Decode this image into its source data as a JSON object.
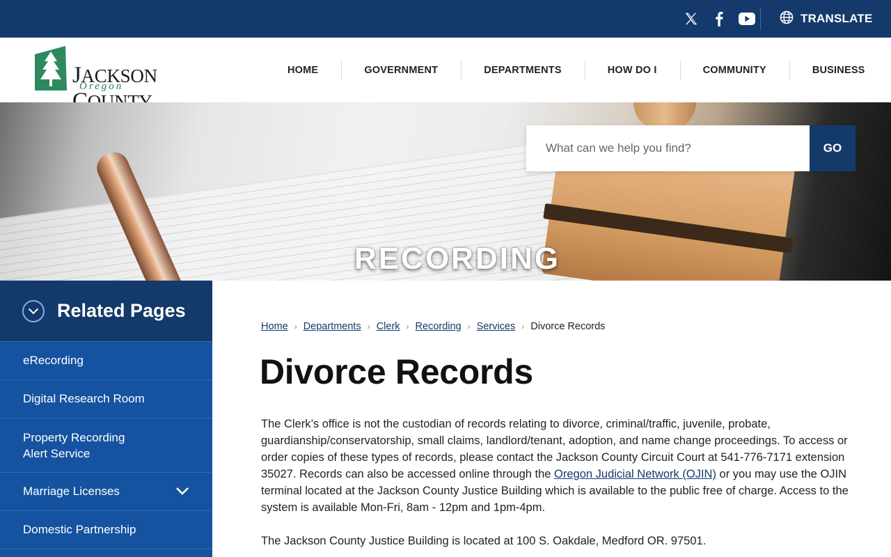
{
  "topbar": {
    "social": [
      "x-icon",
      "facebook-icon",
      "youtube-icon"
    ],
    "translate_label": "TRANSLATE"
  },
  "logo": {
    "name_part1": "J",
    "name_part2": "ACKSON ",
    "name_part3": "C",
    "name_part4": "OUNTY",
    "sub": "Oregon"
  },
  "nav": [
    "HOME",
    "GOVERNMENT",
    "DEPARTMENTS",
    "HOW DO I",
    "COMMUNITY",
    "BUSINESS"
  ],
  "hero": {
    "title": "RECORDING"
  },
  "search": {
    "placeholder": "What can we help you find?",
    "go_label": "GO"
  },
  "sidebar": {
    "heading": "Related Pages",
    "items": [
      {
        "label": "eRecording"
      },
      {
        "label": "Digital Research Room"
      },
      {
        "label_line1": "Property Recording",
        "label_line2": "Alert Service"
      },
      {
        "label": "Marriage Licenses"
      },
      {
        "label": "Domestic Partnership"
      }
    ]
  },
  "breadcrumb": {
    "items": [
      "Home",
      "Departments",
      "Clerk",
      "Recording",
      "Services"
    ],
    "current": "Divorce Records"
  },
  "page": {
    "title": "Divorce Records",
    "p1_before": "The Clerk’s office is not the custodian of records relating to divorce, criminal/traffic, juvenile, probate, guardianship/conservatorship, small claims, landlord/tenant, adoption, and name change proceedings. To access or order copies of these types of records, please contact the Jackson County Circuit Court at 541-776-7171 extension 35027. Records can also be accessed online through the ",
    "p1_link": "Oregon Judicial Network (OJIN)",
    "p1_after": " or you may use the OJIN terminal located at the Jackson County Justice Building which is available to the public free of charge. Access to the system is available Mon-Fri, 8am - 12pm and 1pm-4pm.",
    "p2": "The Jackson County Justice Building is located at 100 S. Oakdale, Medford OR. 97501."
  }
}
